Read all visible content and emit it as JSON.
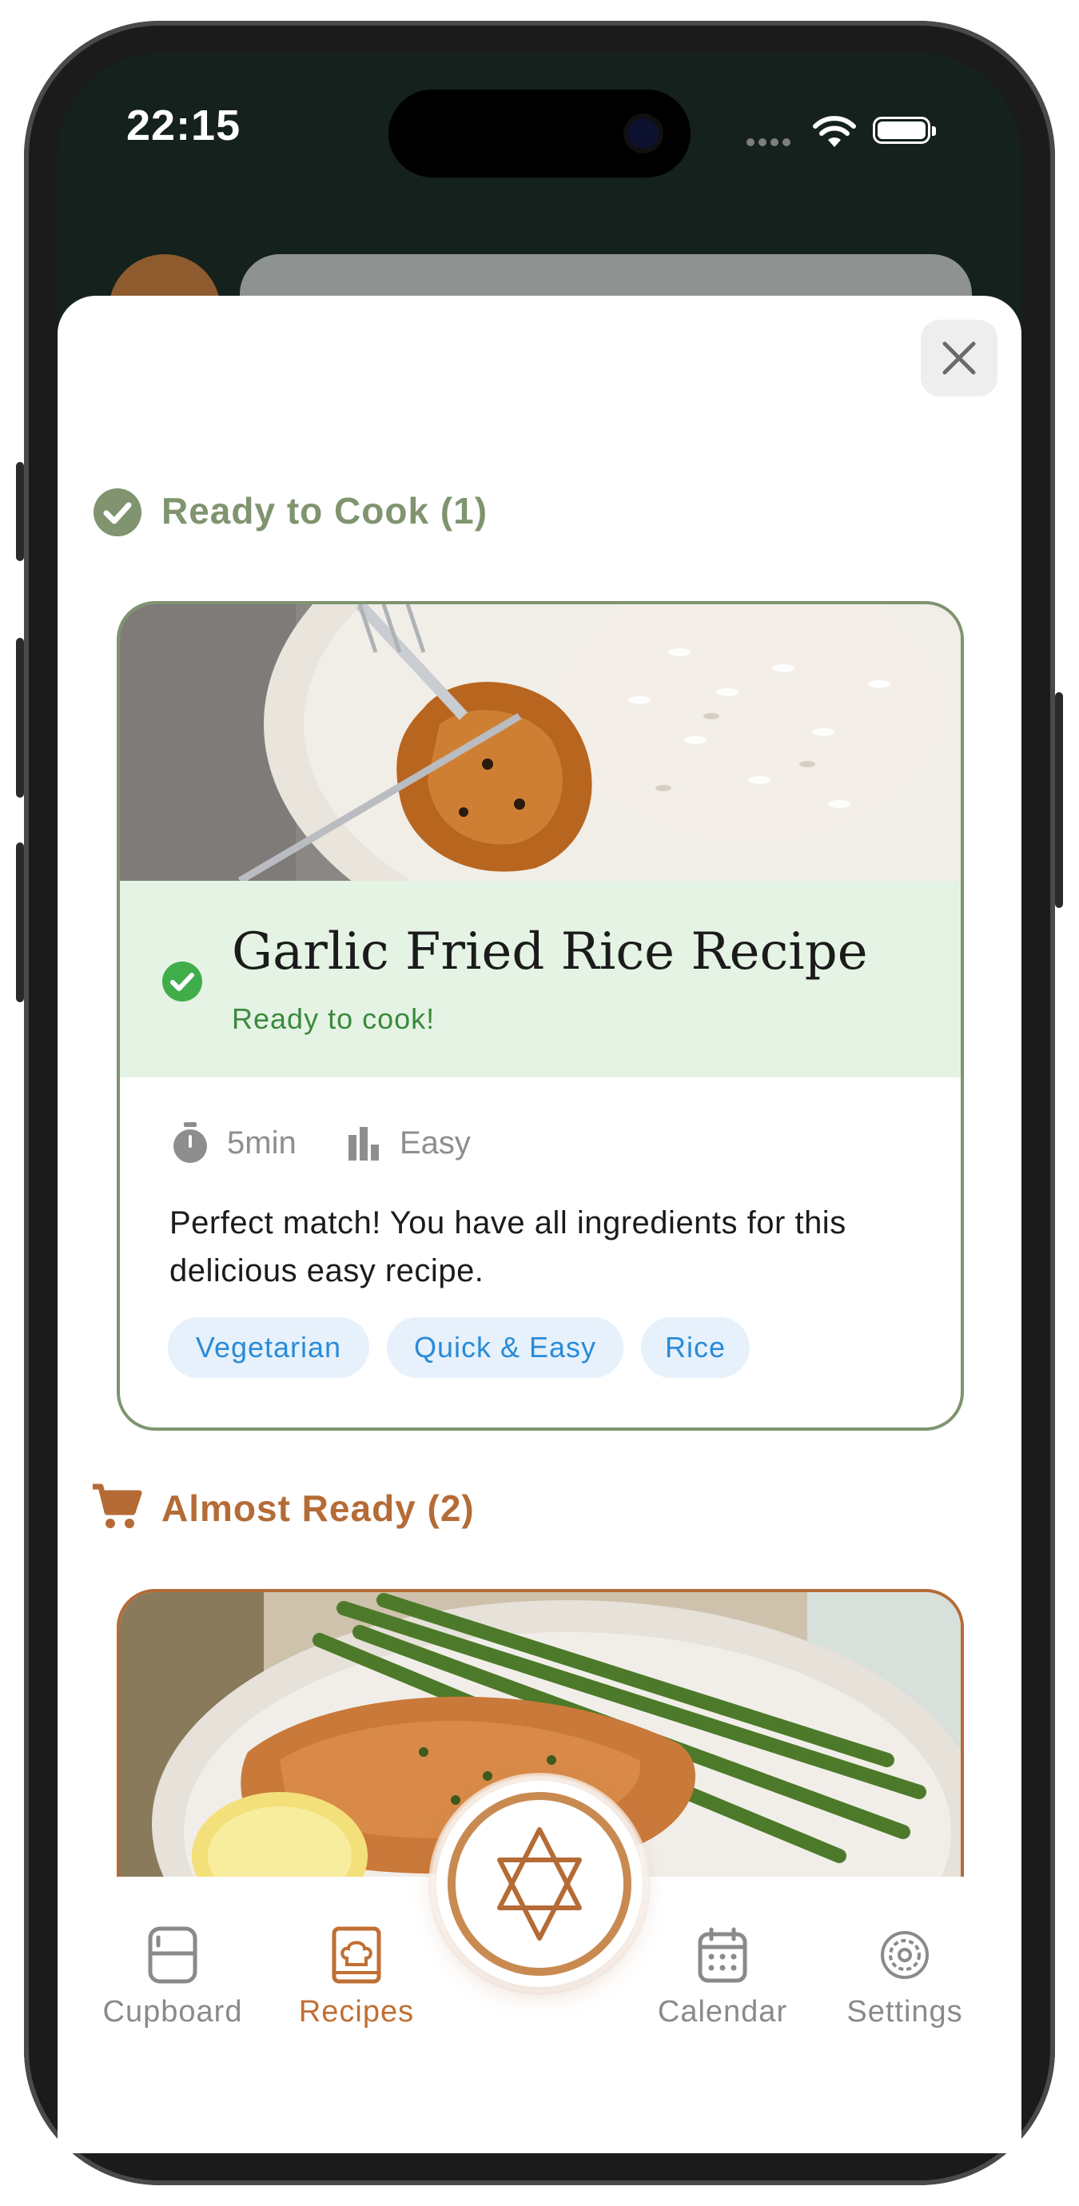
{
  "status_bar": {
    "time": "22:15"
  },
  "sections": {
    "ready": {
      "title": "Ready to Cook (1)"
    },
    "almost": {
      "title": "Almost Ready (2)"
    }
  },
  "recipe_card": {
    "title": "Garlic Fried Rice Recipe",
    "status": "Ready to cook!",
    "time": "5min",
    "difficulty": "Easy",
    "description": "Perfect match! You have all ingredients for this delicious easy recipe.",
    "tags": [
      "Vegetarian",
      "Quick & Easy",
      "Rice"
    ]
  },
  "tab_bar": {
    "items": [
      {
        "label": "Cupboard",
        "icon": "fridge-icon"
      },
      {
        "label": "Recipes",
        "icon": "recipe-book-icon",
        "active": true
      },
      {
        "label": "Calendar",
        "icon": "calendar-icon"
      },
      {
        "label": "Settings",
        "icon": "gear-icon"
      }
    ],
    "center_icon": "star-logo-icon"
  },
  "colors": {
    "ready_green": "#7f946f",
    "ready_band": "#e5f3e5",
    "accent_orange": "#b56b36",
    "chip_bg": "#e6f1fb",
    "chip_text": "#2a8bd8",
    "tab_inactive": "#8a8a8a"
  }
}
